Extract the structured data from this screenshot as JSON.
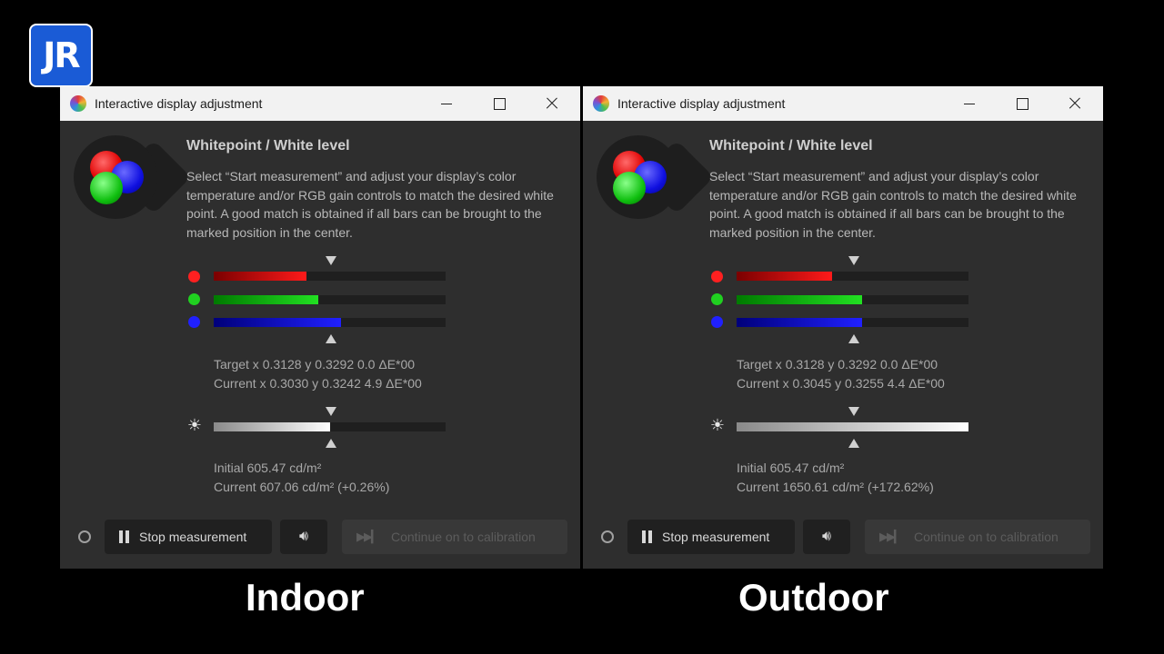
{
  "logo": {
    "text": "JR",
    "color": "#1a5bd6"
  },
  "dialog": {
    "title": "Interactive display adjustment",
    "heading": "Whitepoint / White level",
    "description": "Select “Start measurement” and adjust your display’s color temperature and/or RGB gain controls to match the desired white point. A good match is obtained if all bars can be brought to the marked position in the center.",
    "buttons": {
      "stop": "Stop measurement",
      "continue": "Continue on to calibration"
    },
    "icons": {
      "app": "displaycal-icon",
      "minimize": "minimize-icon",
      "maximize": "maximize-icon",
      "close": "close-icon",
      "sound": "speaker-icon",
      "brightness": "sun-icon",
      "pause": "pause-icon",
      "skip": "skip-forward-icon"
    }
  },
  "panels": [
    {
      "caption": "Indoor",
      "target_line": "Target x 0.3128 y 0.3292 0.0 ΔE*00",
      "current_line": "Current x 0.3030 y 0.3242 4.9 ΔE*00",
      "initial_lum": "Initial 605.47 cd/m²",
      "current_lum": "Current 607.06 cd/m² (+0.26%)",
      "bars": {
        "red": 0.4,
        "green": 0.45,
        "blue": 0.55,
        "white": 0.5
      }
    },
    {
      "caption": "Outdoor",
      "target_line": "Target x 0.3128 y 0.3292 0.0 ΔE*00",
      "current_line": "Current x 0.3045 y 0.3255 4.4 ΔE*00",
      "initial_lum": "Initial 605.47 cd/m²",
      "current_lum": "Current 1650.61 cd/m² (+172.62%)",
      "bars": {
        "red": 0.41,
        "green": 0.54,
        "blue": 0.54,
        "white": 1.0
      }
    }
  ]
}
